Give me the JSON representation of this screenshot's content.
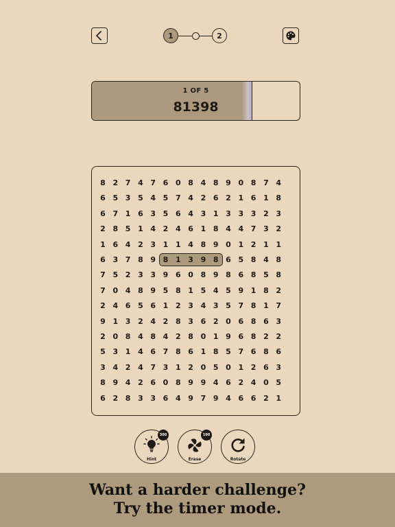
{
  "header": {
    "back_icon": "chevron-left-icon",
    "palette_icon": "palette-icon",
    "steps": [
      "1",
      "2"
    ],
    "current_step": 1
  },
  "progress": {
    "counter": "1 OF 5",
    "target": "81398",
    "fill_fraction": 0.77
  },
  "grid": {
    "rows": [
      "827476084890874",
      "653545742621618",
      "671635643133323",
      "285142461844732",
      "164231148901211",
      "637898139865848",
      "752339608986858",
      "704895815459182",
      "246561234357817",
      "913242836206863",
      "208484280196822",
      "531467861857686",
      "342473120501263",
      "894260899462405",
      "628336497946621"
    ],
    "highlight": {
      "row": 5,
      "col_start": 5,
      "col_end": 9
    }
  },
  "tools": [
    {
      "label": "Hint",
      "badge": "300",
      "icon": "lightbulb-icon"
    },
    {
      "label": "Erase",
      "badge": "100",
      "icon": "fan-icon"
    },
    {
      "label": "Rotate",
      "badge": "",
      "icon": "rotate-icon"
    }
  ],
  "banner": {
    "line1": "Want a harder challenge?",
    "line2": "Try the timer mode."
  },
  "colors": {
    "background": "#ead7bd",
    "accent": "#ad9a7e",
    "banner": "#ae9a7c",
    "ink": "#1e1b17"
  }
}
